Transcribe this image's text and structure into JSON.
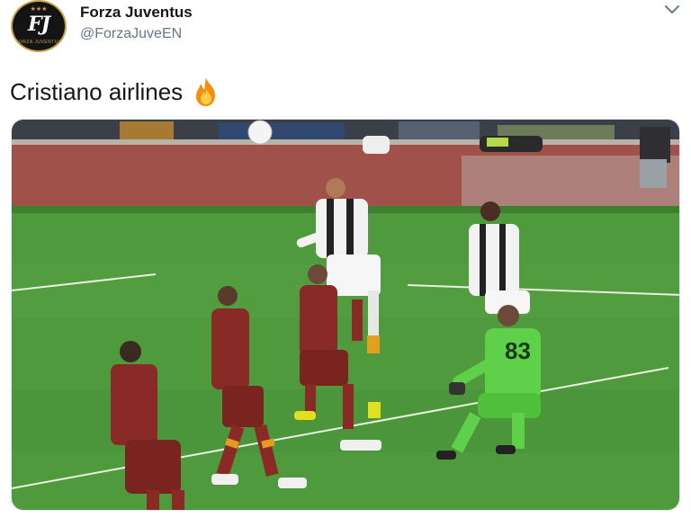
{
  "tweet": {
    "author": {
      "display_name": "Forza Juventus",
      "handle": "@ForzaJuveEN",
      "avatar_monogram": "FJ",
      "avatar_ring_text": "FORZA JUVENTUS"
    },
    "text": "Cristiano airlines",
    "emoji": "fire-icon",
    "menu_icon": "chevron-down-icon",
    "media": {
      "kind": "photo",
      "description_icon": "football-match-photo",
      "jersey_number": "83"
    }
  },
  "colors": {
    "pitch": "#4f9a3c",
    "roma_kit": "#8a2a26",
    "juve_kit": "#f2f2f2",
    "keeper_kit": "#5fd04a",
    "handle": "#657786",
    "text": "#14171a"
  }
}
